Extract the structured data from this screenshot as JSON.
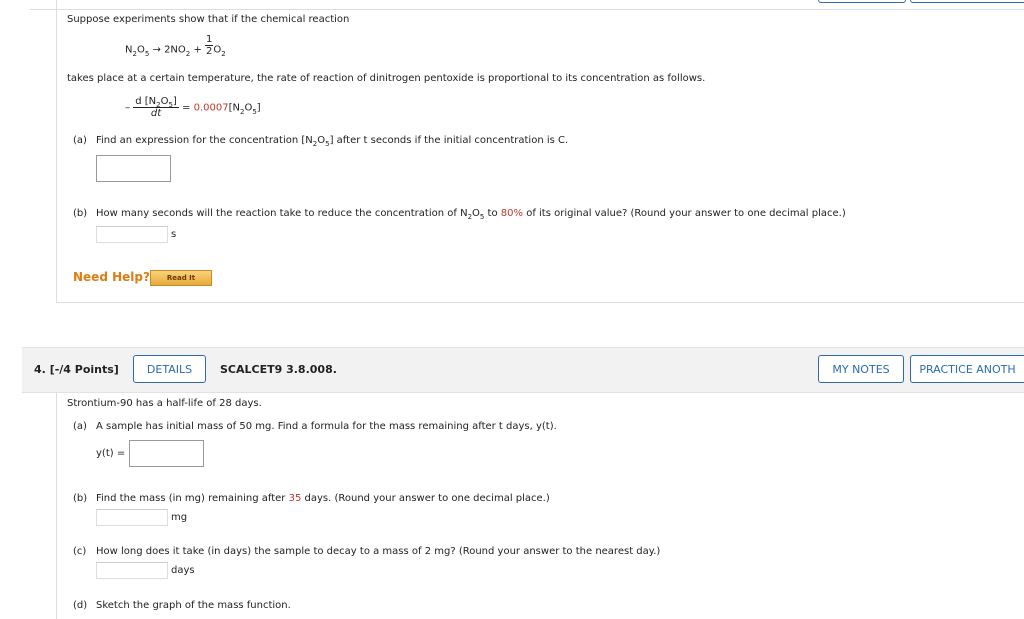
{
  "problem3": {
    "intro": "Suppose experiments show that if the chemical reaction",
    "reaction": {
      "n2o5_base": "N",
      "sub2": "2",
      "o_letter": "O",
      "sub5": "5",
      "arrow": "→",
      "product1": "2NO",
      "sub2b": "2",
      "plus": "+",
      "frac_num": "1",
      "frac_den": "2",
      "o2": "O",
      "sub2c": "2"
    },
    "rate_text": "takes place at a certain temperature, the rate of reaction of dinitrogen pentoxide is proportional to its concentration as follows.",
    "rate_eq": {
      "minus": "–",
      "numer": "d [N",
      "numer_sub2": "2",
      "numer_o": "O",
      "numer_sub5": "5",
      "numer_close": "]",
      "denom": "dt",
      "equals": "=",
      "coef": "0.0007",
      "rhs": "[N",
      "rhs_sub2": "2",
      "rhs_o": "O",
      "rhs_sub5": "5",
      "rhs_close": "]"
    },
    "part_a": {
      "label": "(a)",
      "text": "Find an expression for the concentration [N",
      "sub2": "2",
      "o": "O",
      "sub5": "5",
      "rest": "] after t seconds if the initial concentration is C."
    },
    "part_b": {
      "label": "(b)",
      "text1": "How many seconds will the reaction take to reduce the concentration of N",
      "sub2": "2",
      "o": "O",
      "sub5": "5",
      "text2": " to ",
      "percent": "80%",
      "text3": " of its original value? (Round your answer to one decimal place.)",
      "unit": "s"
    },
    "need_help": "Need Help?",
    "read_it": "Read It"
  },
  "problem4": {
    "number": "4.",
    "points": "[-/4 Points]",
    "details": "DETAILS",
    "code": "SCALCET9 3.8.008.",
    "my_notes": "MY NOTES",
    "practice": "PRACTICE ANOTH",
    "intro": "Strontium-90 has a half-life of 28 days.",
    "part_a": {
      "label": "(a)",
      "text": "A sample has initial mass of 50 mg. Find a formula for the mass remaining after t days, y(t).",
      "lhs": "y(t) ="
    },
    "part_b": {
      "label": "(b)",
      "text1": "Find the mass (in mg) remaining after ",
      "days_value": "35",
      "text2": " days. (Round your answer to one decimal place.)",
      "unit": "mg"
    },
    "part_c": {
      "label": "(c)",
      "text": "How long does it take (in days) the sample to decay to a mass of 2 mg? (Round your answer to the nearest day.)",
      "unit": "days"
    },
    "part_d": {
      "label": "(d)",
      "text": "Sketch the graph of the mass function."
    }
  }
}
